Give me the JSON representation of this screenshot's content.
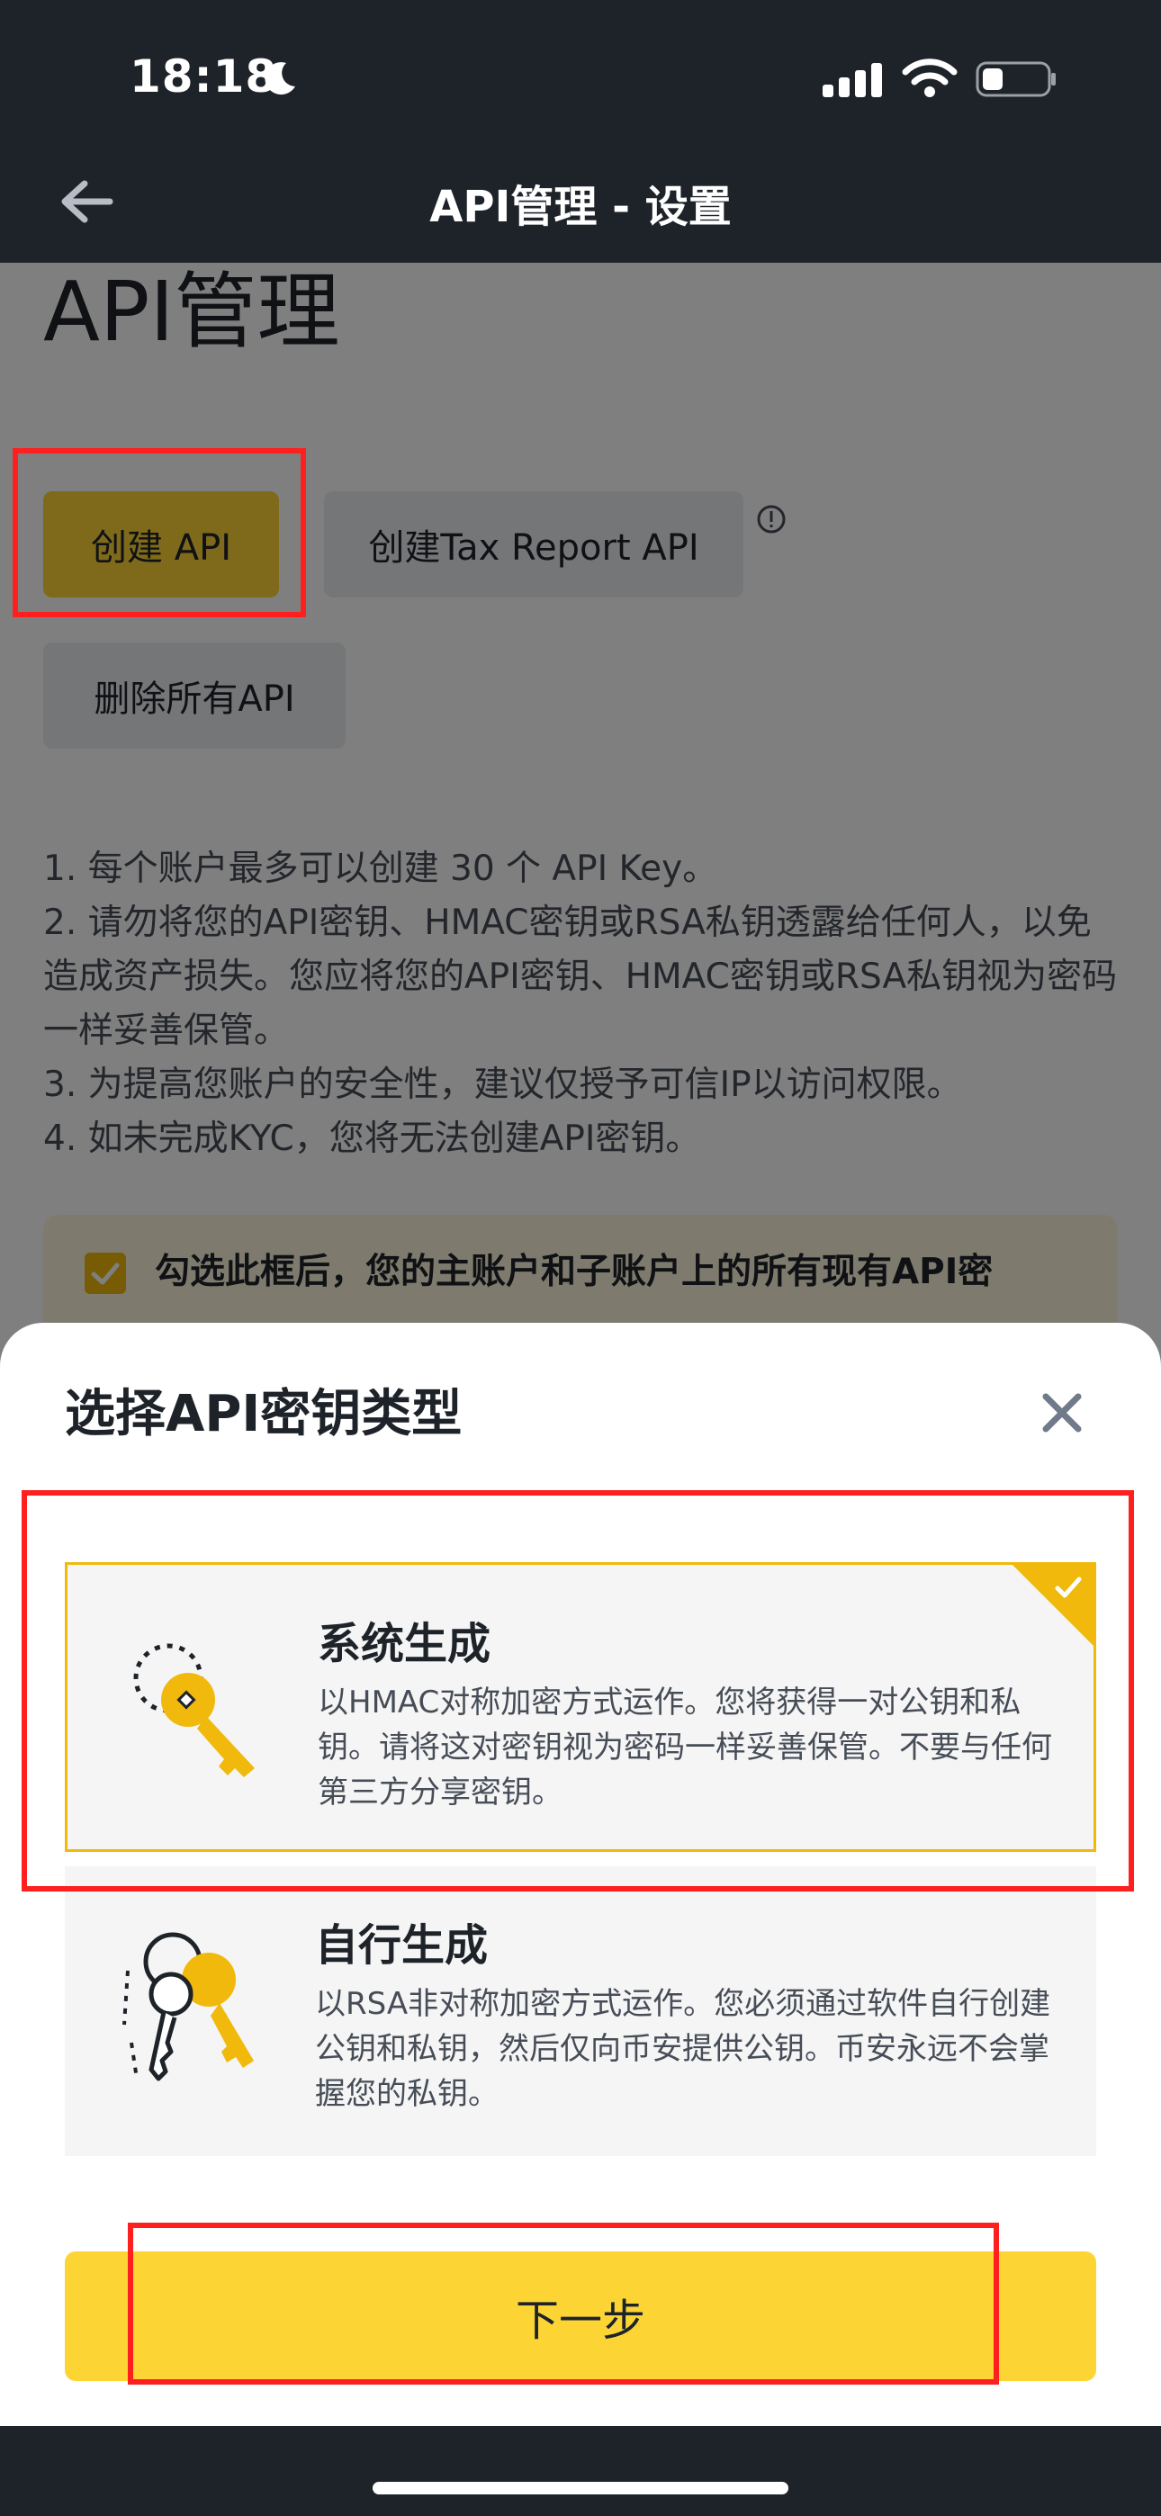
{
  "status_bar": {
    "time": "18:18"
  },
  "header": {
    "title": "API管理 - 设置"
  },
  "page": {
    "title": "API管理",
    "buttons": {
      "create": "创建 API",
      "tax": "创建Tax Report API",
      "delete": "删除所有API"
    },
    "notes": [
      "1. 每个账户最多可以创建 30 个 API Key。",
      "2. 请勿将您的API密钥、HMAC密钥或RSA私钥透露给任何人，以免造成资产损失。您应将您的API密钥、HMAC密钥或RSA私钥视为密码一样妥善保管。",
      "3. 为提高您账户的安全性，建议仅授予可信IP以访问权限。",
      "4. 如未完成KYC，您将无法创建API密钥。"
    ],
    "warning": "勾选此框后，您的主账户和子账户上的所有现有API密"
  },
  "sheet": {
    "title": "选择API密钥类型",
    "options": [
      {
        "title": "系统生成",
        "desc": "以HMAC对称加密方式运作。您将获得一对公钥和私钥。请将这对密钥视为密码一样妥善保管。不要与任何第三方分享密钥。",
        "selected": true
      },
      {
        "title": "自行生成",
        "desc": "以RSA非对称加密方式运作。您必须通过软件自行创建公钥和私钥，然后仅向币安提供公钥。币安永远不会掌握您的私钥。",
        "selected": false
      }
    ],
    "next_label": "下一步"
  },
  "colors": {
    "brand_yellow": "#fcd535",
    "accent_gold": "#f0b90b",
    "header_bg": "#1e2329",
    "highlight_red": "#ff1f1f"
  },
  "icons": [
    "moon-icon",
    "signal-icon",
    "wifi-icon",
    "battery-icon",
    "back-arrow-icon",
    "info-icon",
    "close-icon",
    "check-icon",
    "key-icon",
    "keys-icon"
  ]
}
